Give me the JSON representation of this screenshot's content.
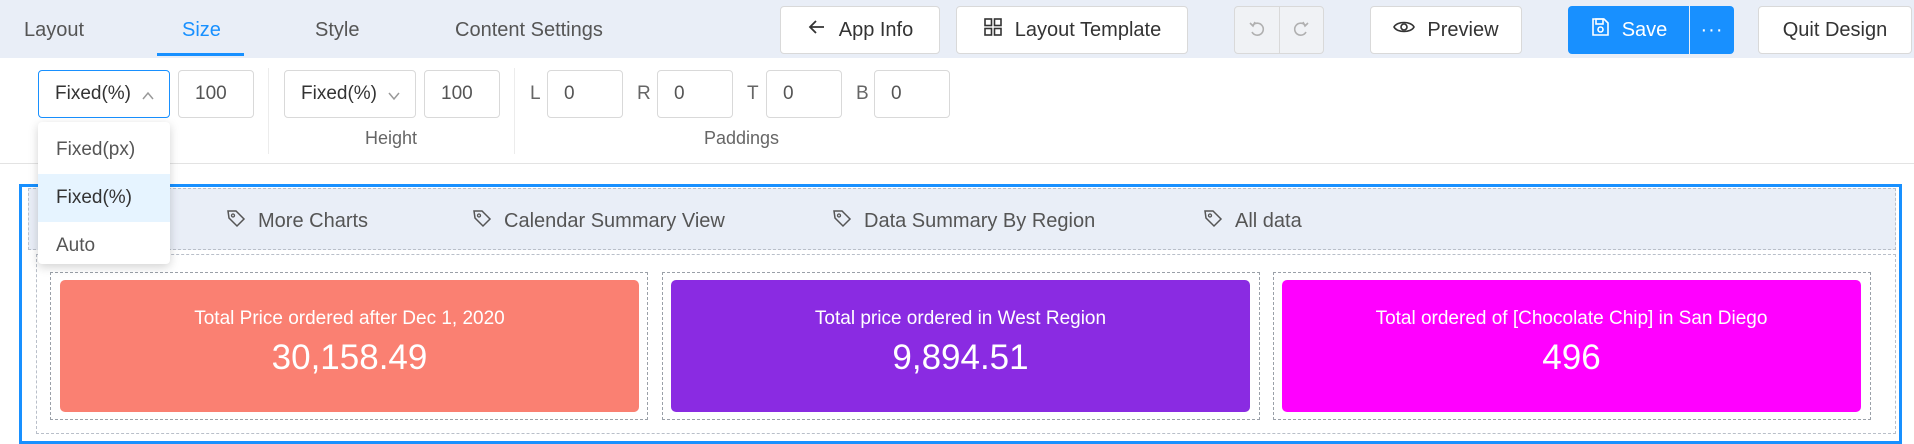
{
  "topbar": {
    "tabs": [
      "Layout",
      "Size",
      "Style",
      "Content Settings"
    ],
    "active_tab": "Size",
    "app_info_label": "App Info",
    "layout_template_label": "Layout Template",
    "preview_label": "Preview",
    "save_label": "Save",
    "more_label": "···",
    "quit_label": "Quit Design"
  },
  "size_panel": {
    "width_mode": "Fixed(%)",
    "width_value": "100",
    "height_mode": "Fixed(%)",
    "height_value": "100",
    "height_label": "Height",
    "paddings_label": "Paddings",
    "padding_l_label": "L",
    "padding_l": "0",
    "padding_r_label": "R",
    "padding_r": "0",
    "padding_t_label": "T",
    "padding_t": "0",
    "padding_b_label": "B",
    "padding_b": "0"
  },
  "dropdown": {
    "options": [
      "Fixed(px)",
      "Fixed(%)",
      "Auto"
    ],
    "selected": "Fixed(%)"
  },
  "dashboard_tabs": [
    "More Charts",
    "Calendar Summary View",
    "Data Summary By Region",
    "All data"
  ],
  "kpi_cards": [
    {
      "title": "Total Price ordered after Dec 1, 2020",
      "value": "30,158.49",
      "color": "#fa8072"
    },
    {
      "title": "Total price ordered in West Region",
      "value": "9,894.51",
      "color": "#8a2be2"
    },
    {
      "title": "Total ordered of [Chocolate Chip] in San Diego",
      "value": "496",
      "color": "#ff00ff"
    }
  ],
  "colors": {
    "accent": "#1890ff",
    "topbar_bg": "#e9eef7"
  }
}
